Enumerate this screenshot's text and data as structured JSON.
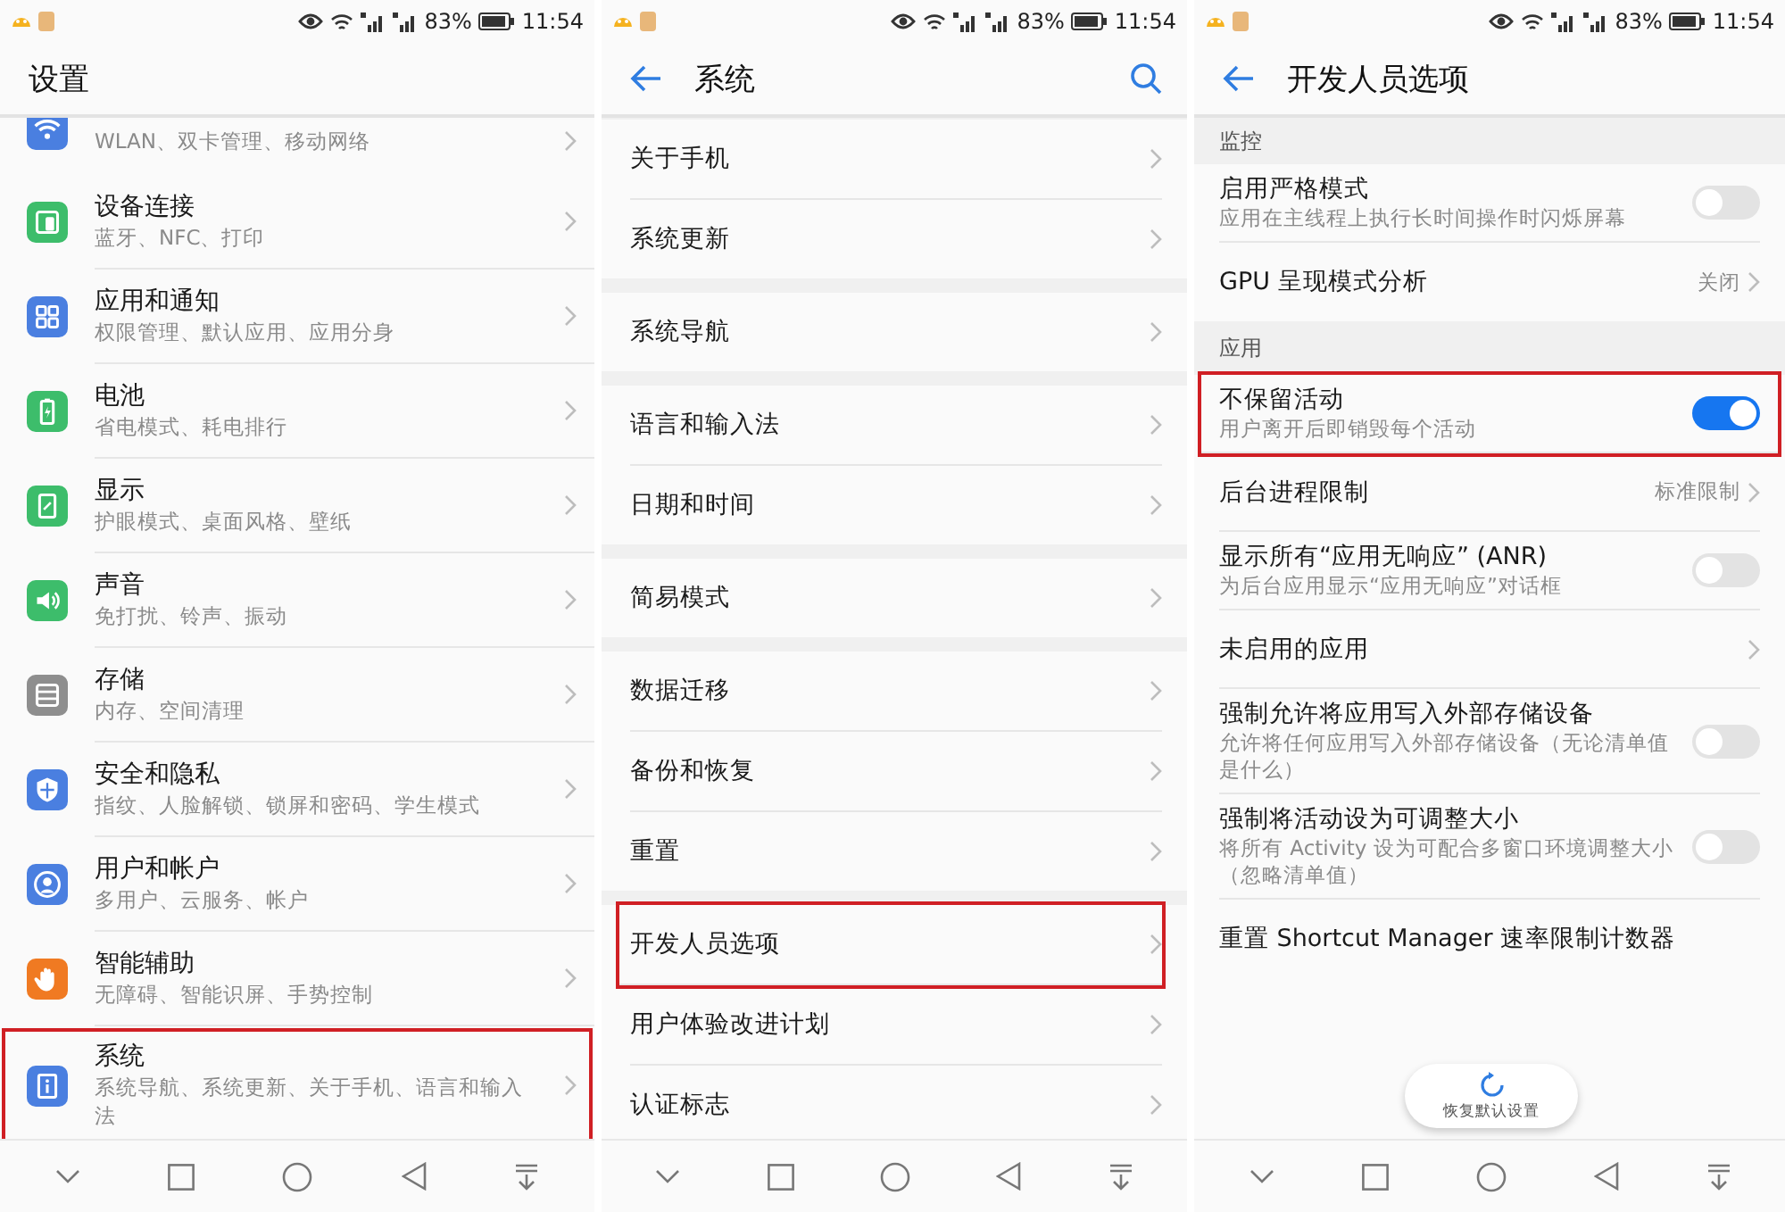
{
  "panels": [
    {
      "status_bar": {
        "battery": "83%",
        "time": "11:54"
      },
      "header": {
        "title": "设置",
        "back": false,
        "search": false
      },
      "settings_list": {
        "items": [
          {
            "subtitle": "WLAN、双卡管理、移动网络",
            "color": "#4a7fe0",
            "highlighted": false
          },
          {
            "title": "设备连接",
            "subtitle": "蓝牙、NFC、打印",
            "color": "#3dbd6b",
            "highlighted": false
          },
          {
            "title": "应用和通知",
            "subtitle": "权限管理、默认应用、应用分身",
            "color": "#4a7fe0",
            "highlighted": false
          },
          {
            "title": "电池",
            "subtitle": "省电模式、耗电排行",
            "color": "#3dbd6b",
            "highlighted": false
          },
          {
            "title": "显示",
            "subtitle": "护眼模式、桌面风格、壁纸",
            "color": "#3dbd6b",
            "highlighted": false
          },
          {
            "title": "声音",
            "subtitle": "免打扰、铃声、振动",
            "color": "#3dbd6b",
            "highlighted": false
          },
          {
            "title": "存储",
            "subtitle": "内存、空间清理",
            "color": "#8e8e8e",
            "highlighted": false
          },
          {
            "title": "安全和隐私",
            "subtitle": "指纹、人脸解锁、锁屏和密码、学生模式",
            "color": "#4a7fe0",
            "highlighted": false
          },
          {
            "title": "用户和帐户",
            "subtitle": "多用户、云服务、帐户",
            "color": "#4a7fe0",
            "highlighted": false
          },
          {
            "title": "智能辅助",
            "subtitle": "无障碍、智能识屏、手势控制",
            "color": "#f07a22",
            "highlighted": false
          },
          {
            "title": "系统",
            "subtitle": "系统导航、系统更新、关于手机、语言和输入法",
            "color": "#4a7fe0",
            "highlighted": true
          }
        ]
      }
    },
    {
      "status_bar": {
        "battery": "83%",
        "time": "11:54"
      },
      "header": {
        "title": "系统",
        "back": true,
        "search": true
      },
      "groups": [
        {
          "items": [
            {
              "title": "关于手机",
              "highlighted": false
            },
            {
              "title": "系统更新",
              "highlighted": false
            }
          ]
        },
        {
          "items": [
            {
              "title": "系统导航",
              "highlighted": false
            }
          ]
        },
        {
          "items": [
            {
              "title": "语言和输入法",
              "highlighted": false
            },
            {
              "title": "日期和时间",
              "highlighted": false
            }
          ]
        },
        {
          "items": [
            {
              "title": "简易模式",
              "highlighted": false
            }
          ]
        },
        {
          "items": [
            {
              "title": "数据迁移",
              "highlighted": false
            },
            {
              "title": "备份和恢复",
              "highlighted": false
            },
            {
              "title": "重置",
              "highlighted": false
            }
          ]
        },
        {
          "items": [
            {
              "title": "开发人员选项",
              "highlighted": true
            },
            {
              "title": "用户体验改进计划",
              "highlighted": false
            },
            {
              "title": "认证标志",
              "highlighted": false
            }
          ]
        }
      ]
    },
    {
      "status_bar": {
        "battery": "83%",
        "time": "11:54"
      },
      "header": {
        "title": "开发人员选项",
        "back": true,
        "search": false
      },
      "options": [
        {
          "kind": "section",
          "title": "监控"
        },
        {
          "kind": "toggle",
          "title": "启用严格模式",
          "subtitle": "应用在主线程上执行长时间操作时闪烁屏幕",
          "on": false,
          "highlighted": false
        },
        {
          "kind": "value",
          "title": "GPU 呈现模式分析",
          "value": "关闭",
          "highlighted": false
        },
        {
          "kind": "section",
          "title": "应用"
        },
        {
          "kind": "toggle",
          "title": "不保留活动",
          "subtitle": "用户离开后即销毁每个活动",
          "on": true,
          "highlighted": true
        },
        {
          "kind": "value",
          "title": "后台进程限制",
          "value": "标准限制",
          "highlighted": false
        },
        {
          "kind": "toggle",
          "title": "显示所有“应用无响应” (ANR)",
          "subtitle": "为后台应用显示“应用无响应”对话框",
          "on": false,
          "highlighted": false
        },
        {
          "kind": "link",
          "title": "未启用的应用",
          "highlighted": false
        },
        {
          "kind": "toggle",
          "title": "强制允许将应用写入外部存储设备",
          "subtitle": "允许将任何应用写入外部存储设备（无论清单值是什么）",
          "on": false,
          "highlighted": false
        },
        {
          "kind": "toggle",
          "title": "强制将活动设为可调整大小",
          "subtitle": "将所有 Activity 设为可配合多窗口环境调整大小（忽略清单值）",
          "on": false,
          "highlighted": false
        },
        {
          "kind": "plain",
          "title": "重置 Shortcut Manager 速率限制计数器",
          "highlighted": false
        }
      ],
      "floating_button": {
        "label": "恢复默认设置"
      }
    }
  ]
}
